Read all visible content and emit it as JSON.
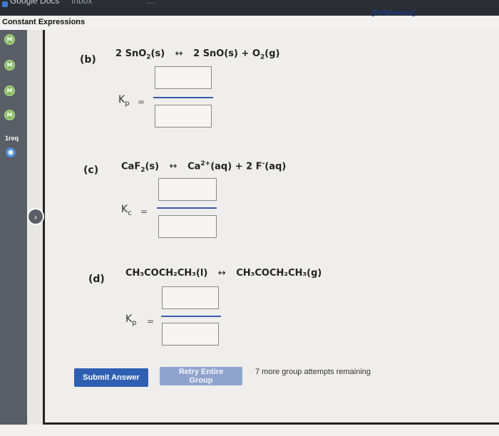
{
  "browser": {
    "tab_1": "Google Docs",
    "tab_2": "Inbox",
    "tab_3": "...."
  },
  "header": {
    "title": "Constant Expressions",
    "references": "[References]"
  },
  "sidebar": {
    "items": [
      {
        "label": "M"
      },
      {
        "label": "M"
      },
      {
        "label": "M"
      },
      {
        "label": "M"
      }
    ],
    "req_label": "1req"
  },
  "parts": {
    "b": {
      "label": "(b)",
      "reactant_coef": "2",
      "reactant": "SnO",
      "reactant_sub": "2",
      "reactant_state": "(s)",
      "arrow": "↔",
      "product1_coef": "2",
      "product1": "SnO(s)",
      "plus": "+",
      "product2": "O",
      "product2_sub": "2",
      "product2_state": "(g)",
      "k_symbol": "K",
      "k_sub": "p",
      "equals": "="
    },
    "c": {
      "label": "(c)",
      "reactant": "CaF",
      "reactant_sub": "2",
      "reactant_state": "(s)",
      "arrow": "↔",
      "product1": "Ca",
      "product1_sup": "2+",
      "product1_state": "(aq)",
      "plus": "+",
      "product2_coef": "2",
      "product2": "F",
      "product2_sup": "-",
      "product2_state": "(aq)",
      "k_symbol": "K",
      "k_sub": "c",
      "equals": "="
    },
    "d": {
      "label": "(d)",
      "reactant": "CH₃COCH₂CH₃(l)",
      "arrow": "↔",
      "product": "CH₃COCH₂CH₃(g)",
      "k_symbol": "K",
      "k_sub": "p",
      "equals": "="
    }
  },
  "buttons": {
    "submit": "Submit Answer",
    "retry": "Retry Entire Group"
  },
  "status": {
    "remaining": "7 more group attempts remaining"
  },
  "colors": {
    "sidebar_bg": "#5a5e66",
    "badge_green": "#7fb45b",
    "submit_blue": "#2f5fb3",
    "retry_blue": "#8fa4cd",
    "fraction_line": "#3a5ab0"
  }
}
